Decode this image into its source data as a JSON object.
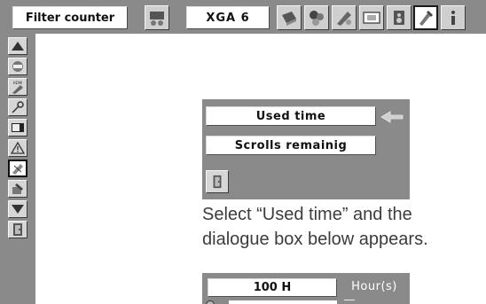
{
  "toolbar": {
    "menu_title": "Filter counter",
    "input_source": "XGA 6",
    "icons": [
      "input-source-icon",
      "pc-adjust-icon",
      "image-select-icon",
      "image-adjust-icon",
      "screen-icon",
      "sound-icon",
      "setting-icon",
      "information-icon"
    ],
    "active_icon": "setting-icon"
  },
  "sidebar": {
    "items": [
      "up-arrow-icon",
      "language-icon",
      "hdmi-setup-icon",
      "security-key-icon",
      "screen-display-icon",
      "warning-icon",
      "filter-counter-icon",
      "test-pattern-icon",
      "down-arrow-icon",
      "exit-door-icon"
    ],
    "active_item": "filter-counter-icon"
  },
  "dialog": {
    "used_time_label": "Used time",
    "scrolls_label": "Scrolls remainig",
    "selected_item": "Used time"
  },
  "caption": {
    "line1": "Select “Used time” and the",
    "line2": "dialogue box below appears."
  },
  "hours": {
    "value": "100 H",
    "unit": "Hour(s)"
  },
  "colors": {
    "panel_gray": "#8a8a8a",
    "field_white": "#ffffff",
    "caption_text": "#3c3c3c"
  }
}
